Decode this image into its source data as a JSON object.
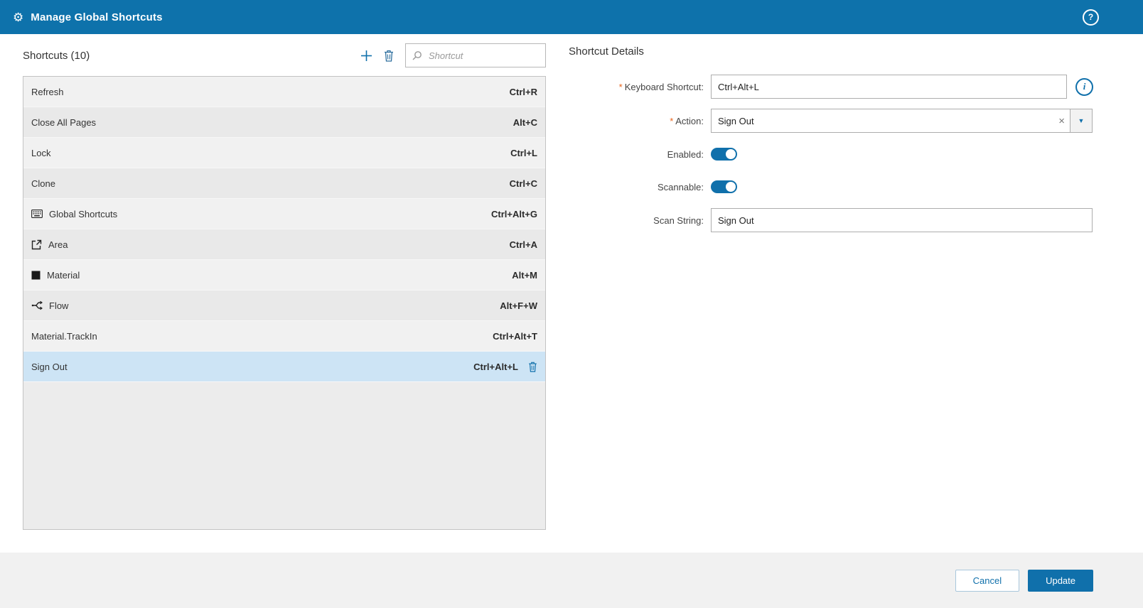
{
  "header": {
    "title": "Manage Global Shortcuts"
  },
  "shortcuts_panel": {
    "title": "Shortcuts (10)",
    "search_placeholder": "Shortcut",
    "rows": [
      {
        "label": "Refresh",
        "keys": "Ctrl+R"
      },
      {
        "label": "Close All Pages",
        "keys": "Alt+C"
      },
      {
        "label": "Lock",
        "keys": "Ctrl+L"
      },
      {
        "label": "Clone",
        "keys": "Ctrl+C"
      },
      {
        "label": "Global Shortcuts",
        "keys": "Ctrl+Alt+G",
        "icon": "keyboard-icon"
      },
      {
        "label": "Area",
        "keys": "Ctrl+A",
        "icon": "area-icon"
      },
      {
        "label": "Material",
        "keys": "Alt+M",
        "icon": "material-icon"
      },
      {
        "label": "Flow",
        "keys": "Alt+F+W",
        "icon": "flow-icon"
      },
      {
        "label": "Material.TrackIn",
        "keys": "Ctrl+Alt+T"
      },
      {
        "label": "Sign Out",
        "keys": "Ctrl+Alt+L",
        "selected": true
      }
    ]
  },
  "details_panel": {
    "title": "Shortcut Details",
    "keyboard_shortcut": {
      "label": "Keyboard Shortcut:",
      "required": "*",
      "value": "Ctrl+Alt+L"
    },
    "action": {
      "label": "Action:",
      "required": "*",
      "value": "Sign Out"
    },
    "enabled": {
      "label": "Enabled:",
      "state": "on"
    },
    "scannable": {
      "label": "Scannable:",
      "state": "on"
    },
    "scan_string": {
      "label": "Scan String:",
      "value": "Sign Out"
    }
  },
  "footer": {
    "cancel_label": "Cancel",
    "update_label": "Update"
  },
  "icons": {
    "titlebar": "shortcuts-gear-icon",
    "help": "question-circle-icon",
    "toolbar": [
      "add-icon",
      "trash-icon",
      "search-icon"
    ],
    "action_field": [
      "clear-icon",
      "chevron-down-icon"
    ],
    "keyboard_shortcut_field": "info-icon",
    "selected_row": "trash-icon"
  },
  "colors": {
    "header_bg": "#0e72ab",
    "accent": "#1070ab",
    "selected_row_bg": "#cde4f5",
    "required": "#e8641b",
    "footer_bg": "#f1f1f1"
  }
}
